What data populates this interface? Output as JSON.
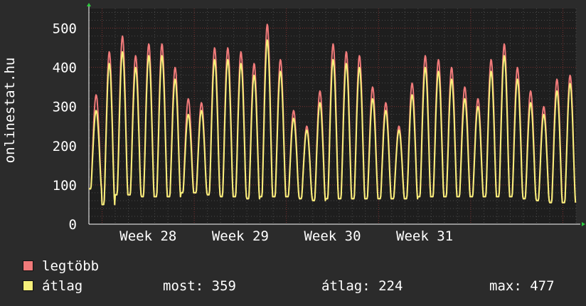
{
  "chart_data": {
    "type": "line",
    "ylabel": "onlinestat.hu",
    "ylim": [
      0,
      550
    ],
    "yticks": [
      0,
      100,
      200,
      300,
      400,
      500
    ],
    "x_ticks": [
      "Week 28",
      "Week 29",
      "Week 30",
      "Week 31"
    ],
    "grid": true,
    "days": 37,
    "series": [
      {
        "name": "legtöbb",
        "color": "#f07a7a",
        "daily_peak": [
          330,
          440,
          480,
          430,
          460,
          460,
          400,
          320,
          310,
          450,
          450,
          440,
          410,
          510,
          420,
          290,
          250,
          340,
          460,
          440,
          430,
          350,
          310,
          250,
          360,
          430,
          420,
          400,
          350,
          320,
          420,
          460,
          400,
          340,
          300,
          370,
          380
        ],
        "daily_min": [
          90,
          50,
          75,
          75,
          70,
          70,
          70,
          80,
          80,
          75,
          70,
          70,
          65,
          70,
          70,
          70,
          65,
          60,
          65,
          65,
          65,
          65,
          65,
          65,
          65,
          70,
          70,
          70,
          70,
          70,
          70,
          70,
          70,
          65,
          60,
          55,
          55
        ]
      },
      {
        "name": "átlag",
        "color": "#f6f07a",
        "daily_peak": [
          290,
          410,
          440,
          400,
          430,
          430,
          370,
          280,
          290,
          420,
          420,
          410,
          380,
          470,
          390,
          270,
          240,
          310,
          420,
          410,
          400,
          320,
          290,
          240,
          330,
          400,
          390,
          370,
          320,
          300,
          390,
          430,
          370,
          310,
          280,
          340,
          359
        ],
        "daily_min": [
          90,
          50,
          75,
          75,
          70,
          70,
          70,
          80,
          80,
          75,
          70,
          70,
          65,
          70,
          70,
          70,
          65,
          60,
          65,
          65,
          65,
          65,
          65,
          65,
          65,
          70,
          70,
          70,
          70,
          70,
          70,
          70,
          70,
          65,
          60,
          55,
          55
        ]
      }
    ]
  },
  "legend": {
    "items": [
      {
        "label": "legtöbb",
        "color": "#f07a7a"
      },
      {
        "label": "átlag",
        "color": "#f6f07a"
      }
    ]
  },
  "stats": {
    "now": "most: 359",
    "avg": "átlag: 224",
    "max": "max: 477"
  }
}
